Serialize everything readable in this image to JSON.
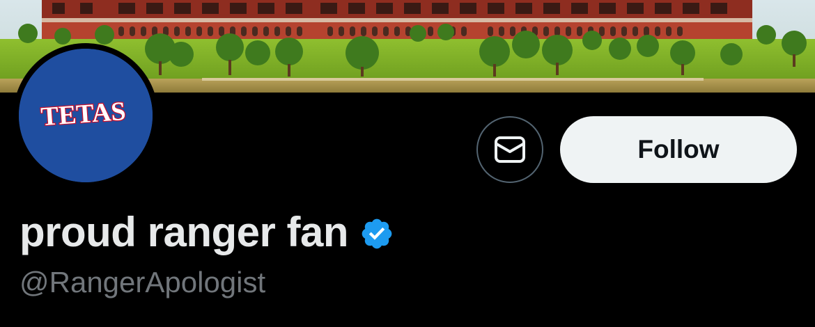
{
  "profile": {
    "display_name": "proud ranger fan",
    "handle": "@RangerApologist",
    "verified": true,
    "avatar_text": "TETAS",
    "avatar_bg": "#1f4ea0"
  },
  "actions": {
    "message_icon": "envelope-icon",
    "follow_label": "Follow"
  },
  "colors": {
    "background": "#000000",
    "name": "#e7e9ea",
    "handle": "#71767b",
    "follow_bg": "#eff3f4",
    "verified_badge": "#1d9bf0"
  }
}
